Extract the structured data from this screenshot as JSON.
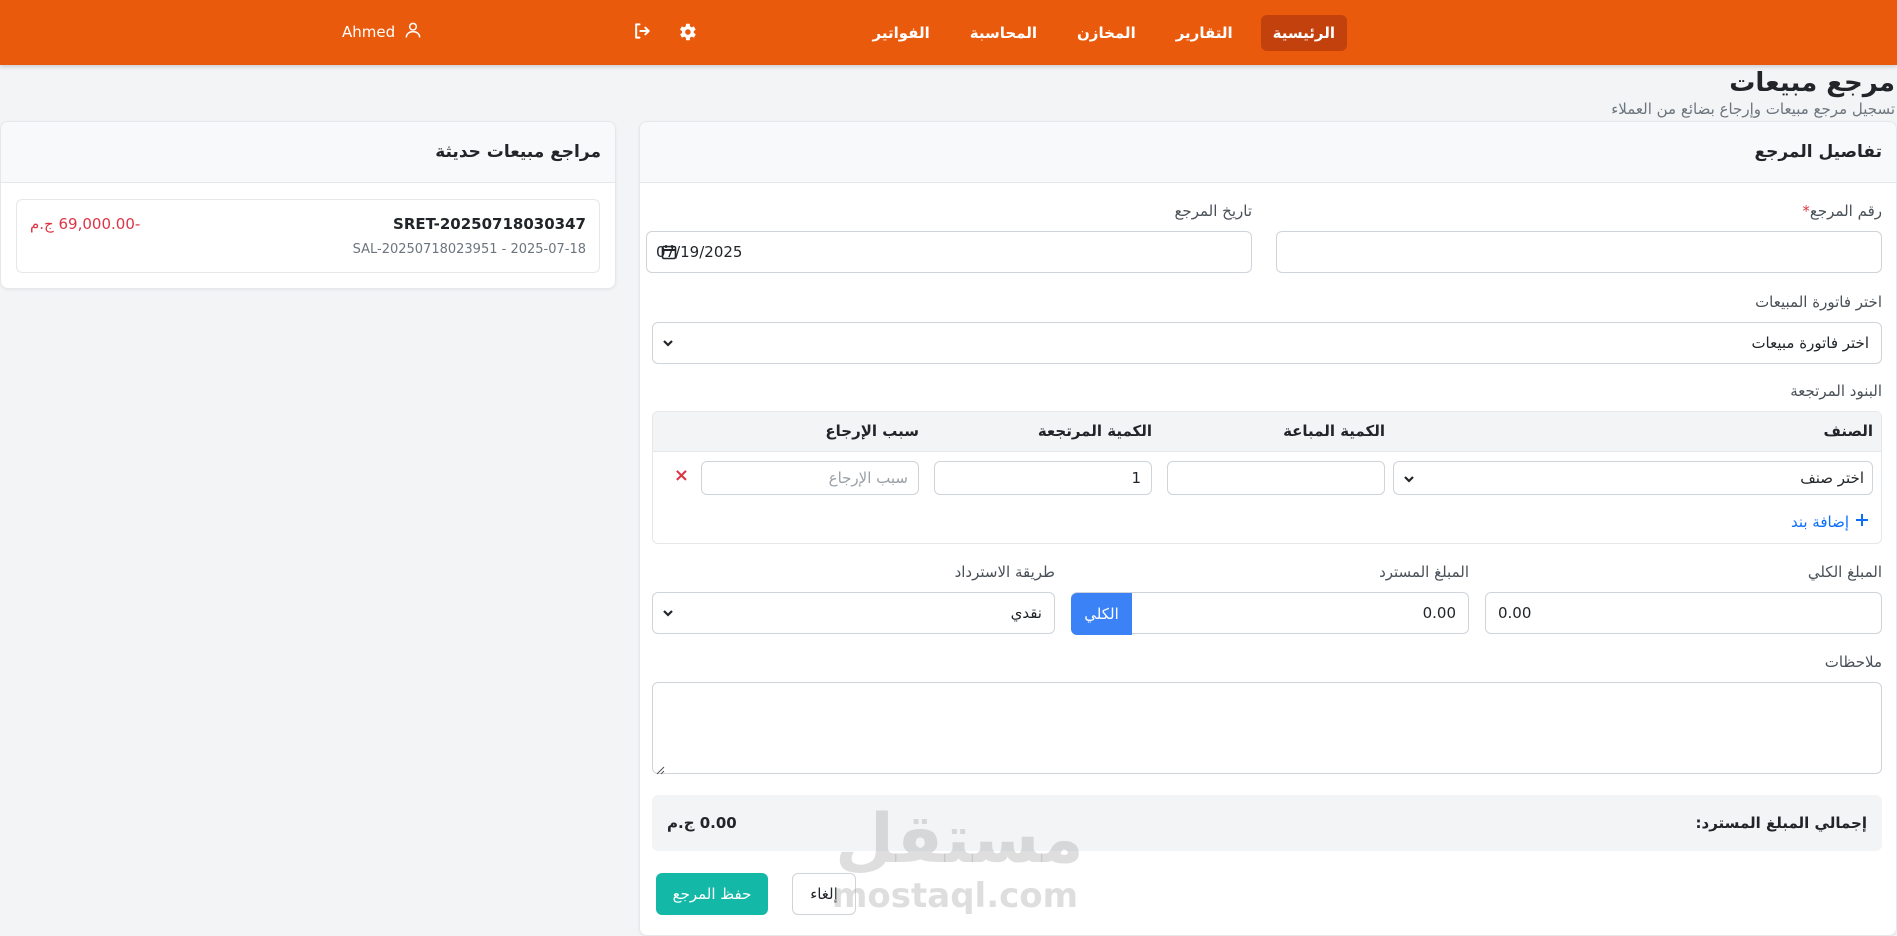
{
  "nav": {
    "links": [
      "الرئيسية",
      "التقارير",
      "المخازن",
      "المحاسبة",
      "الفواتير"
    ],
    "active_index": 0,
    "settings_icon": "gear-icon",
    "logout_icon": "sign-out-icon",
    "user_name": "Ahmed",
    "user_icon": "user-icon"
  },
  "page": {
    "title": "مرجع مبيعات",
    "subtitle": "تسجيل مرجع مبيعات وإرجاع بضائع من العملاء"
  },
  "form": {
    "card_title": "تفاصيل المرجع",
    "ref_number_label": "رقم المرجع",
    "ref_number_required_mark": "*",
    "ref_number_value": "",
    "date_label": "تاريخ المرجع",
    "date_value": "07/19/2025",
    "invoice_label": "اختر فاتورة المبيعات",
    "invoice_value": "اختر فاتورة مبيعات",
    "items_label": "البنود المرتجعة",
    "items_headers": {
      "item": "الصنف",
      "sold_qty": "الكمية المباعة",
      "returned_qty": "الكمية المرتجعة",
      "reason": "سبب الإرجاع"
    },
    "item_row": {
      "item_value": "اختر صنف",
      "sold_qty_value": "",
      "returned_qty_value": "1",
      "reason_placeholder": "سبب الإرجاع",
      "remove_symbol": "×"
    },
    "add_item_label": "إضافة بند",
    "total_label": "المبلغ الكلي",
    "total_value": "0.00",
    "refund_label": "المبلغ المسترد",
    "refund_value": "0.00",
    "full_button_label": "الكلي",
    "method_label": "طريقة الاسترداد",
    "method_value": "نقدي",
    "notes_label": "ملاحظات",
    "notes_value": "",
    "summary_label": "إجمالي المبلغ المسترد:",
    "summary_value": "0.00 ج.م",
    "save_button": "حفظ المرجع",
    "cancel_button": "إلغاء"
  },
  "recent": {
    "title": "مراجع مبيعات حديثة",
    "items": [
      {
        "code": "SRET-20250718030347",
        "meta": "SAL-20250718023951 - 2025-07-18",
        "amount": "-69,000.00 ج.م"
      }
    ]
  },
  "watermark": {
    "text": "مستقل",
    "url": "mostaql.com"
  },
  "colors": {
    "navbar": "#ea5a0c",
    "nav_active": "#c2410c",
    "primary": "#3b82f6",
    "save": "#14b8a6",
    "danger": "#dc3545"
  }
}
